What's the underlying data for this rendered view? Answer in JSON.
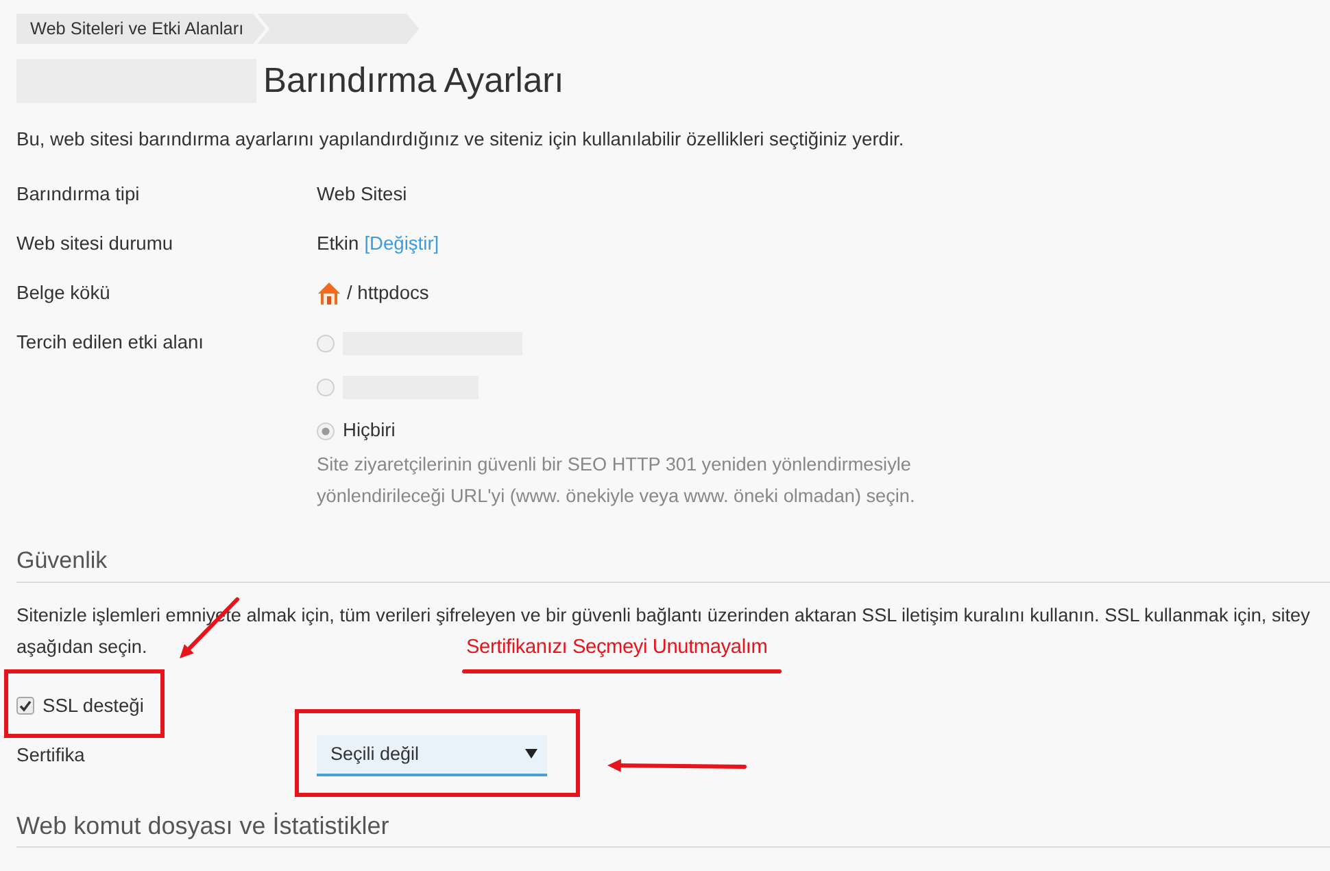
{
  "breadcrumb": {
    "label": "Web Siteleri ve Etki Alanları"
  },
  "title": "Barındırma Ayarları",
  "description": "Bu, web sitesi barındırma ayarlarını yapılandırdığınız ve siteniz için kullanılabilir özellikleri seçtiğiniz yerdir.",
  "settings": [
    {
      "kind": "text",
      "label": "Barındırma tipi",
      "value": "Web Sitesi"
    },
    {
      "kind": "status",
      "label": "Web sitesi durumu",
      "value": "Etkin",
      "link": "[Değiştir]"
    },
    {
      "kind": "path",
      "label": "Belge kökü",
      "value": "/ httpdocs"
    },
    {
      "kind": "radios",
      "label": "Tercih edilen etki alanı",
      "options": [
        {
          "kind": "redacted",
          "selected": false
        },
        {
          "kind": "redacted",
          "selected": false
        },
        {
          "kind": "label",
          "label": "Hiçbiri",
          "selected": true
        }
      ],
      "hint_lines": [
        "Site ziyaretçilerinin güvenli bir SEO HTTP 301 yeniden yönlendirmesiyle",
        "yönlendirileceği URL'yi (www. önekiyle veya www. öneki olmadan) seçin."
      ]
    }
  ],
  "security": {
    "heading": "Güvenlik",
    "text_lines": [
      "Sitenizle işlemleri emniyete almak için, tüm verileri şifreleyen ve bir güvenli bağlantı üzerinden aktaran SSL iletişim kuralını kullanın. SSL kullanmak için, sitey",
      "aşağıdan seçin."
    ],
    "ssl": {
      "label": "SSL desteği",
      "checked": true
    },
    "certificate": {
      "label": "Sertifika",
      "value": "Seçili değil"
    }
  },
  "next_section": {
    "heading": "Web komut dosyası ve İstatistikler"
  },
  "annotation": {
    "note": "Sertifikanızı Seçmeyi Unutmayalım"
  }
}
